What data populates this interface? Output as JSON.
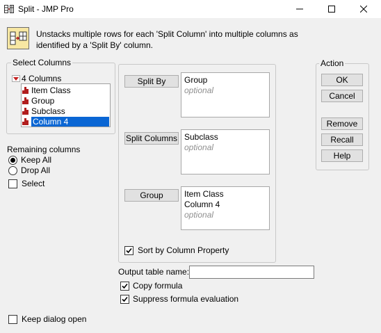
{
  "window": {
    "title": "Split - JMP Pro",
    "icons": {
      "app": "split-table-icon",
      "minimize": "minimize-icon",
      "maximize": "maximize-icon",
      "close": "close-icon"
    }
  },
  "banner": {
    "icon": "split-columns-icon",
    "description": "Unstacks multiple rows for each 'Split Column' into multiple columns as identified by a 'Split By' column."
  },
  "select_columns": {
    "title": "Select Columns",
    "count_label": "4 Columns",
    "columns": [
      {
        "name": "Item Class",
        "icon": "nominal-icon"
      },
      {
        "name": "Group",
        "icon": "nominal-icon"
      },
      {
        "name": "Subclass",
        "icon": "nominal-icon"
      },
      {
        "name": "Column 4",
        "icon": "nominal-icon",
        "selected": true
      }
    ]
  },
  "remaining_columns": {
    "label": "Remaining columns",
    "options": [
      "Keep All",
      "Drop All"
    ],
    "selected": "Keep All",
    "select_label": "Select",
    "select_checked": false
  },
  "roles": {
    "split_by": {
      "button": "Split By",
      "values": [
        "Group"
      ],
      "placeholder": "optional"
    },
    "split_columns": {
      "button": "Split Columns",
      "values": [
        "Subclass"
      ],
      "placeholder": "optional"
    },
    "group": {
      "button": "Group",
      "values": [
        "Item Class",
        "Column 4"
      ],
      "placeholder": "optional"
    },
    "sort_by_column_property": {
      "label": "Sort by Column Property",
      "checked": true
    }
  },
  "output": {
    "table_name_label": "Output table name:",
    "table_name_value": "",
    "copy_formula": {
      "label": "Copy formula",
      "checked": true
    },
    "suppress_formula": {
      "label": "Suppress formula evaluation",
      "checked": true
    }
  },
  "action": {
    "title": "Action",
    "buttons": [
      "OK",
      "Cancel",
      "Remove",
      "Recall",
      "Help"
    ]
  },
  "keep_dialog_open": {
    "label": "Keep dialog open",
    "checked": false
  },
  "colors": {
    "selection": "#0a66d4",
    "nominal_icon": "#b11e1e",
    "expander_triangle": "#c41e1e"
  }
}
